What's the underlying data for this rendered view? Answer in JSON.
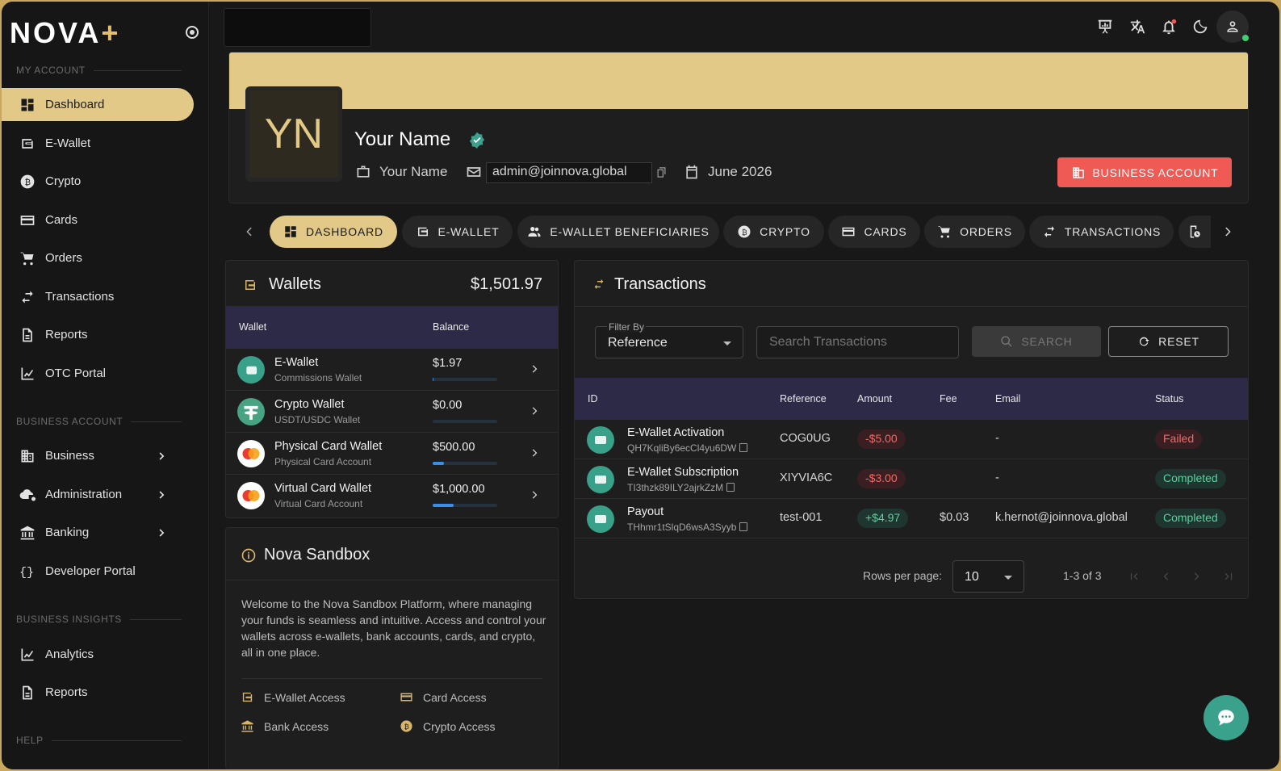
{
  "brand": {
    "logo_text": "NOVA",
    "logo_plus": "+"
  },
  "sidebar": {
    "sections": [
      "MY ACCOUNT",
      "BUSINESS ACCOUNT",
      "BUSINESS INSIGHTS",
      "HELP"
    ],
    "items": [
      {
        "label": "Dashboard",
        "icon": "dashboard-icon"
      },
      {
        "label": "E-Wallet",
        "icon": "wallet-icon"
      },
      {
        "label": "Crypto",
        "icon": "bitcoin-icon"
      },
      {
        "label": "Cards",
        "icon": "credit-card-icon"
      },
      {
        "label": "Orders",
        "icon": "cart-icon"
      },
      {
        "label": "Transactions",
        "icon": "swap-icon"
      },
      {
        "label": "Reports",
        "icon": "document-icon"
      },
      {
        "label": "OTC Portal",
        "icon": "chart-line-icon"
      },
      {
        "label": "Business",
        "icon": "building-icon"
      },
      {
        "label": "Administration",
        "icon": "cloud-gear-icon"
      },
      {
        "label": "Banking",
        "icon": "bank-icon"
      },
      {
        "label": "Developer Portal",
        "icon": "braces-icon"
      },
      {
        "label": "Analytics",
        "icon": "chart-line-icon"
      },
      {
        "label": "Reports",
        "icon": "document-icon"
      }
    ]
  },
  "profile": {
    "initials": "YN",
    "name": "Your Name",
    "company": "Your Name",
    "email": "admin@joinnova.global",
    "date": "June 2026",
    "business_button": "BUSINESS ACCOUNT"
  },
  "tabs": [
    "DASHBOARD",
    "E-WALLET",
    "E-WALLET BENEFICIARIES",
    "CRYPTO",
    "CARDS",
    "ORDERS",
    "TRANSACTIONS"
  ],
  "wallets": {
    "title": "Wallets",
    "total": "$1,501.97",
    "col_wallet": "Wallet",
    "col_balance": "Balance",
    "rows": [
      {
        "name": "E-Wallet",
        "sub": "Commissions Wallet",
        "balance": "$1.97",
        "progress": 0.001
      },
      {
        "name": "Crypto Wallet",
        "sub": "USDT/USDC Wallet",
        "balance": "$0.00",
        "progress": 0
      },
      {
        "name": "Physical Card Wallet",
        "sub": "Physical Card Account",
        "balance": "$500.00",
        "progress": 0.17
      },
      {
        "name": "Virtual Card Wallet",
        "sub": "Virtual Card Account",
        "balance": "$1,000.00",
        "progress": 0.33
      }
    ]
  },
  "sandbox": {
    "title": "Nova Sandbox",
    "text": "Welcome to the Nova Sandbox Platform, where managing your funds is seamless and intuitive. Access and control your wallets across e-wallets, bank accounts, cards, and crypto, all in one place.",
    "access": [
      "E-Wallet Access",
      "Card Access",
      "Bank Access",
      "Crypto Access"
    ]
  },
  "transactions": {
    "title": "Transactions",
    "filter_label": "Filter By",
    "filter_value": "Reference",
    "search_placeholder": "Search Transactions",
    "search_button": "SEARCH",
    "reset_button": "RESET",
    "columns": [
      "ID",
      "Reference",
      "Amount",
      "Fee",
      "Email",
      "Status"
    ],
    "rows": [
      {
        "name": "E-Wallet Activation",
        "id": "QH7KqliBy6ecCl4yu6DW",
        "reference": "COG0UG",
        "amount": "-$5.00",
        "fee": "",
        "email": "-",
        "status": "Failed"
      },
      {
        "name": "E-Wallet Subscription",
        "id": "TI3thzk89ILY2ajrkZzM",
        "reference": "XIYVIA6C",
        "amount": "-$3.00",
        "fee": "",
        "email": "-",
        "status": "Completed"
      },
      {
        "name": "Payout",
        "id": "THhmr1tSlqD6wsA3Syyb",
        "reference": "test-001",
        "amount": "+$4.97",
        "fee": "$0.03",
        "email": "k.hernot@joinnova.global",
        "status": "Completed"
      }
    ],
    "rows_per_page_label": "Rows per page:",
    "rows_per_page": "10",
    "range": "1-3 of 3"
  },
  "colors": {
    "accent": "#e3c987",
    "danger": "#f05a55",
    "success": "#5fd0a0"
  }
}
